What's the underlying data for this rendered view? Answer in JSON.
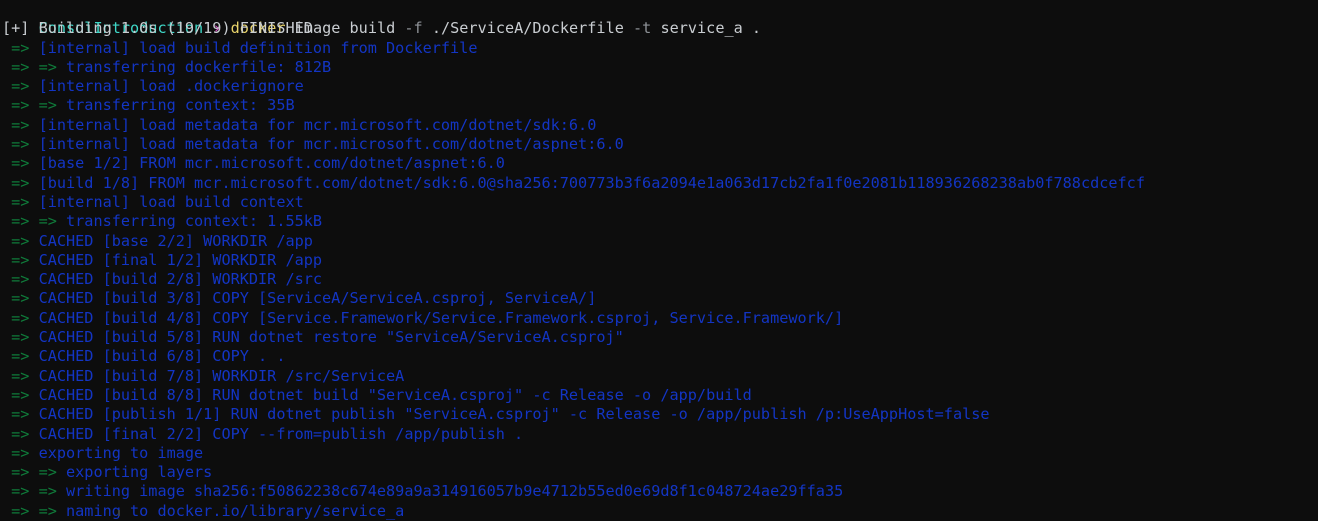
{
  "terminal": {
    "background_color": "#0d0d0d",
    "colors": {
      "directory": "#3fd8c8",
      "chevron": "#d94fc4",
      "command": "#e8d36a",
      "argument": "#c9cdd1",
      "flag": "#8d9196",
      "arrow": "#0f7b3a",
      "body": "#1335c4",
      "status": "#c9cdd1"
    },
    "prompt": {
      "directory": "ConsulIntroduction",
      "chevron": "›",
      "command": "docker",
      "args": [
        {
          "text": "image",
          "type": "arg"
        },
        {
          "text": "build",
          "type": "arg"
        },
        {
          "text": "-f",
          "type": "flag"
        },
        {
          "text": "./ServiceA/Dockerfile",
          "type": "arg"
        },
        {
          "text": "-t",
          "type": "flag"
        },
        {
          "text": "service_a",
          "type": "arg"
        },
        {
          "text": ".",
          "type": "arg"
        }
      ]
    },
    "status_line": "[+] Building 1.0s (19/19) FINISHED",
    "build_steps": [
      {
        "arrow": "=>",
        "text": "[internal] load build definition from Dockerfile"
      },
      {
        "arrow": "=> =>",
        "text": "transferring dockerfile: 812B"
      },
      {
        "arrow": "=>",
        "text": "[internal] load .dockerignore"
      },
      {
        "arrow": "=> =>",
        "text": "transferring context: 35B"
      },
      {
        "arrow": "=>",
        "text": "[internal] load metadata for mcr.microsoft.com/dotnet/sdk:6.0"
      },
      {
        "arrow": "=>",
        "text": "[internal] load metadata for mcr.microsoft.com/dotnet/aspnet:6.0"
      },
      {
        "arrow": "=>",
        "text": "[base 1/2] FROM mcr.microsoft.com/dotnet/aspnet:6.0"
      },
      {
        "arrow": "=>",
        "text": "[build 1/8] FROM mcr.microsoft.com/dotnet/sdk:6.0@sha256:700773b3f6a2094e1a063d17cb2fa1f0e2081b118936268238ab0f788cdcefcf"
      },
      {
        "arrow": "=>",
        "text": "[internal] load build context"
      },
      {
        "arrow": "=> =>",
        "text": "transferring context: 1.55kB"
      },
      {
        "arrow": "=>",
        "text": "CACHED [base 2/2] WORKDIR /app"
      },
      {
        "arrow": "=>",
        "text": "CACHED [final 1/2] WORKDIR /app"
      },
      {
        "arrow": "=>",
        "text": "CACHED [build 2/8] WORKDIR /src"
      },
      {
        "arrow": "=>",
        "text": "CACHED [build 3/8] COPY [ServiceA/ServiceA.csproj, ServiceA/]"
      },
      {
        "arrow": "=>",
        "text": "CACHED [build 4/8] COPY [Service.Framework/Service.Framework.csproj, Service.Framework/]"
      },
      {
        "arrow": "=>",
        "text": "CACHED [build 5/8] RUN dotnet restore \"ServiceA/ServiceA.csproj\""
      },
      {
        "arrow": "=>",
        "text": "CACHED [build 6/8] COPY . ."
      },
      {
        "arrow": "=>",
        "text": "CACHED [build 7/8] WORKDIR /src/ServiceA"
      },
      {
        "arrow": "=>",
        "text": "CACHED [build 8/8] RUN dotnet build \"ServiceA.csproj\" -c Release -o /app/build"
      },
      {
        "arrow": "=>",
        "text": "CACHED [publish 1/1] RUN dotnet publish \"ServiceA.csproj\" -c Release -o /app/publish /p:UseAppHost=false"
      },
      {
        "arrow": "=>",
        "text": "CACHED [final 2/2] COPY --from=publish /app/publish ."
      },
      {
        "arrow": "=>",
        "text": "exporting to image"
      },
      {
        "arrow": "=> =>",
        "text": "exporting layers"
      },
      {
        "arrow": "=> =>",
        "text": "writing image sha256:f50862238c674e89a9a314916057b9e4712b55ed0e69d8f1c048724ae29ffa35"
      },
      {
        "arrow": "=> =>",
        "text": "naming to docker.io/library/service_a"
      }
    ]
  }
}
